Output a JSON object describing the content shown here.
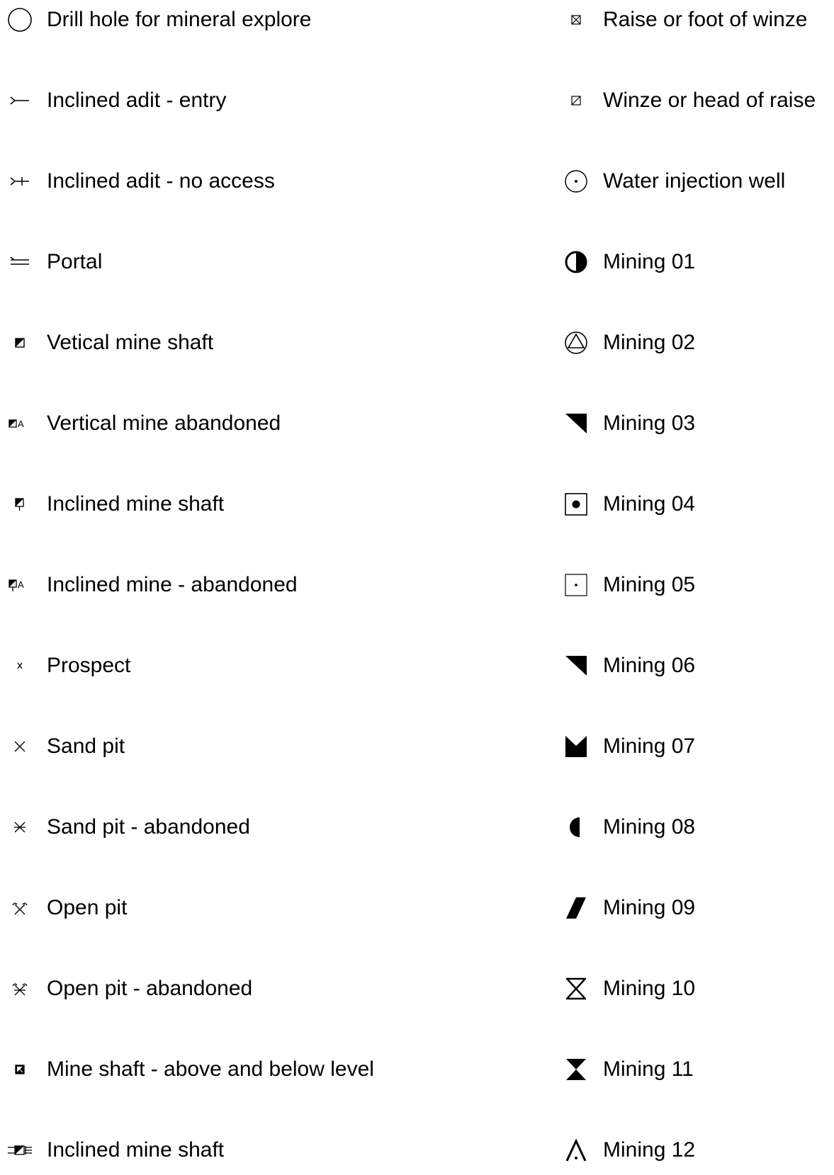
{
  "legend": {
    "left": [
      {
        "icon": "drill-hole-icon",
        "label": "Drill hole for mineral explore"
      },
      {
        "icon": "inclined-adit-entry-icon",
        "label": "Inclined adit - entry"
      },
      {
        "icon": "inclined-adit-no-access-icon",
        "label": "Inclined adit - no access"
      },
      {
        "icon": "portal-icon",
        "label": "Portal"
      },
      {
        "icon": "vertical-mine-shaft-icon",
        "label": "Vetical mine shaft"
      },
      {
        "icon": "vertical-mine-abandoned-icon",
        "label": "Vertical mine abandoned"
      },
      {
        "icon": "inclined-mine-shaft-icon",
        "label": "Inclined mine shaft"
      },
      {
        "icon": "inclined-mine-abandoned-icon",
        "label": "Inclined mine - abandoned"
      },
      {
        "icon": "prospect-icon",
        "label": "Prospect"
      },
      {
        "icon": "sand-pit-icon",
        "label": "Sand pit"
      },
      {
        "icon": "sand-pit-abandoned-icon",
        "label": "Sand pit - abandoned"
      },
      {
        "icon": "open-pit-icon",
        "label": "Open pit"
      },
      {
        "icon": "open-pit-abandoned-icon",
        "label": "Open pit - abandoned"
      },
      {
        "icon": "mine-shaft-above-below-icon",
        "label": "Mine shaft - above and below level"
      },
      {
        "icon": "inclined-mine-shaft-horizontal-icon",
        "label": "Inclined mine shaft"
      }
    ],
    "right": [
      {
        "icon": "raise-foot-winze-icon",
        "label": "Raise or foot of winze"
      },
      {
        "icon": "winze-head-raise-icon",
        "label": "Winze or head of raise"
      },
      {
        "icon": "water-injection-well-icon",
        "label": "Water injection well"
      },
      {
        "icon": "mining-01-icon",
        "label": "Mining 01"
      },
      {
        "icon": "mining-02-icon",
        "label": "Mining 02"
      },
      {
        "icon": "mining-03-icon",
        "label": "Mining 03"
      },
      {
        "icon": "mining-04-icon",
        "label": "Mining 04"
      },
      {
        "icon": "mining-05-icon",
        "label": "Mining 05"
      },
      {
        "icon": "mining-06-icon",
        "label": "Mining 06"
      },
      {
        "icon": "mining-07-icon",
        "label": "Mining 07"
      },
      {
        "icon": "mining-08-icon",
        "label": "Mining 08"
      },
      {
        "icon": "mining-09-icon",
        "label": "Mining 09"
      },
      {
        "icon": "mining-10-icon",
        "label": "Mining 10"
      },
      {
        "icon": "mining-11-icon",
        "label": "Mining 11"
      },
      {
        "icon": "mining-12-icon",
        "label": "Mining 12"
      }
    ]
  }
}
